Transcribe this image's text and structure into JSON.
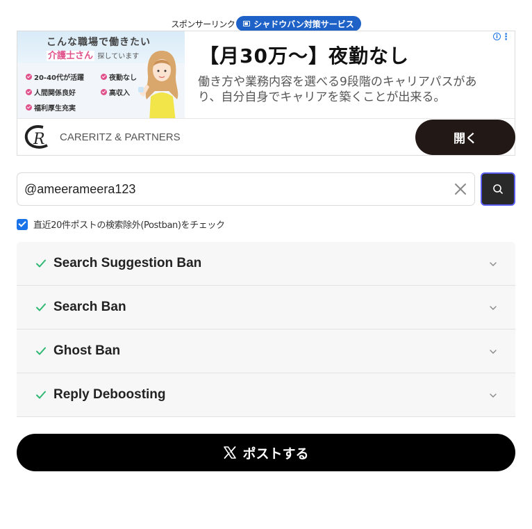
{
  "sponsor": {
    "label": "スポンサーリンク",
    "badge_label": "シャドウバン対策サービス",
    "badge_color": "#1e62c8"
  },
  "ad": {
    "image": {
      "line1": "こんな職場で働きたい",
      "line2_highlight": "介護士さん",
      "line2_rest": "探しています",
      "features": [
        "20-40代が活躍",
        "夜勤なし",
        "人間関係良好",
        "高収入",
        "福利厚生充実"
      ]
    },
    "headline": "【月30万〜】夜勤なし",
    "body": "働き方や業務内容を選べる9段階のキャリアパスがあり、自分自身でキャリアを築くことが出来る。",
    "brand": "CARERITZ & PARTNERS",
    "open_label": "開く",
    "info_icon": "info-icon",
    "more_icon": "more-vert-icon"
  },
  "search": {
    "value": "@ameerameera123",
    "clear_icon": "close-icon",
    "button_icon": "search-icon"
  },
  "postban_option": {
    "checked": true,
    "label": "直近20件ポストの検索除外(Postban)をチェック"
  },
  "results": [
    {
      "title": "Search Suggestion Ban",
      "status": "ok"
    },
    {
      "title": "Search Ban",
      "status": "ok"
    },
    {
      "title": "Ghost Ban",
      "status": "ok"
    },
    {
      "title": "Reply Deboosting",
      "status": "ok"
    }
  ],
  "post_button": {
    "label": "ポストする",
    "icon": "x-logo-icon"
  },
  "colors": {
    "check_green": "#2eb872",
    "accent_blue": "#1a73e8",
    "button_dark": "#221816"
  }
}
